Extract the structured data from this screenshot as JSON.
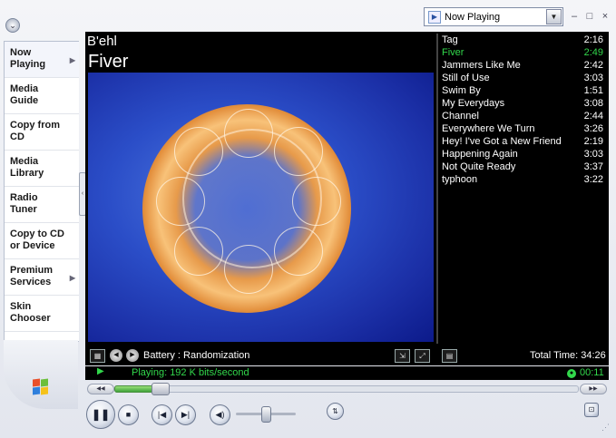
{
  "window": {
    "view_selector": "Now Playing",
    "controls": {
      "minimize": "–",
      "maximize": "□",
      "close": "×"
    }
  },
  "sidebar": {
    "items": [
      {
        "label": "Now Playing",
        "line1": "Now",
        "line2": "Playing",
        "has_arrow": true,
        "active": true
      },
      {
        "label": "Media Guide",
        "line1": "Media",
        "line2": "Guide",
        "has_arrow": false
      },
      {
        "label": "Copy from CD",
        "line1": "Copy from",
        "line2": "CD",
        "has_arrow": false
      },
      {
        "label": "Media Library",
        "line1": "Media",
        "line2": "Library",
        "has_arrow": false
      },
      {
        "label": "Radio Tuner",
        "line1": "Radio",
        "line2": "Tuner",
        "has_arrow": false
      },
      {
        "label": "Copy to CD or Device",
        "line1": "Copy to CD",
        "line2": "or Device",
        "has_arrow": false
      },
      {
        "label": "Premium Services",
        "line1": "Premium",
        "line2": "Services",
        "has_arrow": true
      },
      {
        "label": "Skin Chooser",
        "line1": "Skin",
        "line2": "Chooser",
        "has_arrow": false
      }
    ]
  },
  "now_playing": {
    "artist": "B'ehl",
    "title": "Fiver",
    "visualization": "Battery : Randomization"
  },
  "playlist": {
    "tracks": [
      {
        "name": "Tag",
        "duration": "2:16"
      },
      {
        "name": "Fiver",
        "duration": "2:49",
        "current": true
      },
      {
        "name": "Jammers Like Me",
        "duration": "2:42"
      },
      {
        "name": "Still of Use",
        "duration": "3:03"
      },
      {
        "name": "Swim By",
        "duration": "1:51"
      },
      {
        "name": "My Everydays",
        "duration": "3:08"
      },
      {
        "name": "Channel",
        "duration": "2:44"
      },
      {
        "name": "Everywhere We Turn",
        "duration": "3:26"
      },
      {
        "name": "Hey! I've Got a New Friend",
        "duration": "2:19"
      },
      {
        "name": "Happening Again",
        "duration": "3:03"
      },
      {
        "name": "Not Quite Ready",
        "duration": "3:37"
      },
      {
        "name": "typhoon",
        "duration": "3:22"
      }
    ],
    "total_time": "Total Time: 34:26"
  },
  "status": {
    "text": "Playing: 192 K bits/second",
    "elapsed": "00:11"
  },
  "seek": {
    "progress": 0.08
  },
  "volume": {
    "level": 0.45
  },
  "colors": {
    "accent_green": "#32d74b",
    "player_bg": "#000000",
    "chrome": "#e3e6ee"
  },
  "icons": [
    "app-menu-icon",
    "now-playing-icon",
    "dropdown-arrow-icon",
    "play-indicator-icon",
    "clock-icon",
    "pause-icon",
    "stop-icon",
    "previous-icon",
    "next-icon",
    "mute-icon",
    "equalizer-icon",
    "compact-mode-icon",
    "windows-logo-icon"
  ]
}
